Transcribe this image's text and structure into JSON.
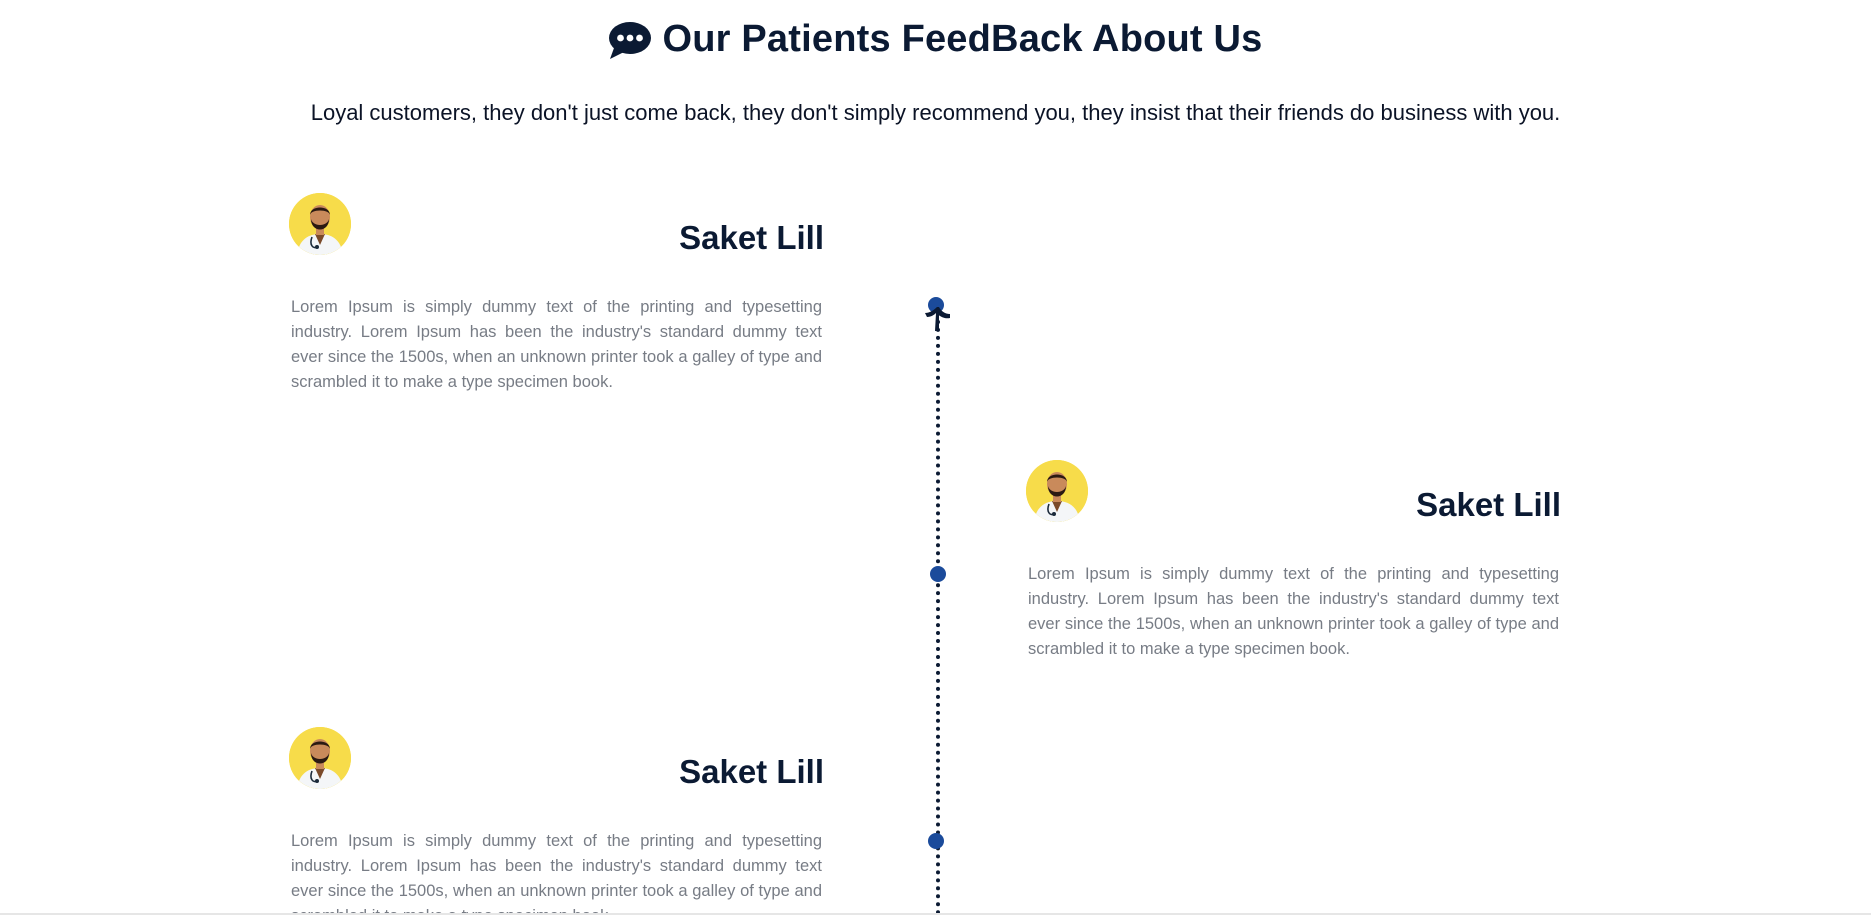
{
  "header": {
    "title": "Our Patients FeedBack About Us",
    "subtitle": "Loyal customers, they don't just come back, they don't simply recommend you, they insist that their friends do business with you.",
    "icon": "chat-bubble-icon"
  },
  "testimonials": [
    {
      "name": "Saket Lill",
      "text": "Lorem Ipsum is simply dummy text of the printing and typesetting industry. Lorem Ipsum has been the industry's standard dummy text ever since the 1500s, when an unknown printer took a galley of type and scrambled it to make a type specimen book.",
      "avatar": "doctor-avatar"
    },
    {
      "name": "Saket Lill",
      "text": "Lorem Ipsum is simply dummy text of the printing and typesetting industry. Lorem Ipsum has been the industry's standard dummy text ever since the 1500s, when an unknown printer took a galley of type and scrambled it to make a type specimen book.",
      "avatar": "doctor-avatar"
    },
    {
      "name": "Saket Lill",
      "text": "Lorem Ipsum is simply dummy text of the printing and typesetting industry. Lorem Ipsum has been the industry's standard dummy text ever since the 1500s, when an unknown printer took a galley of type and scrambled it to make a type specimen book.",
      "avatar": "doctor-avatar"
    }
  ],
  "colors": {
    "heading": "#0b1a33",
    "body_text": "#777c85",
    "timeline_dot": "#1b4b9b",
    "avatar_bg": "#f7dc4a"
  }
}
